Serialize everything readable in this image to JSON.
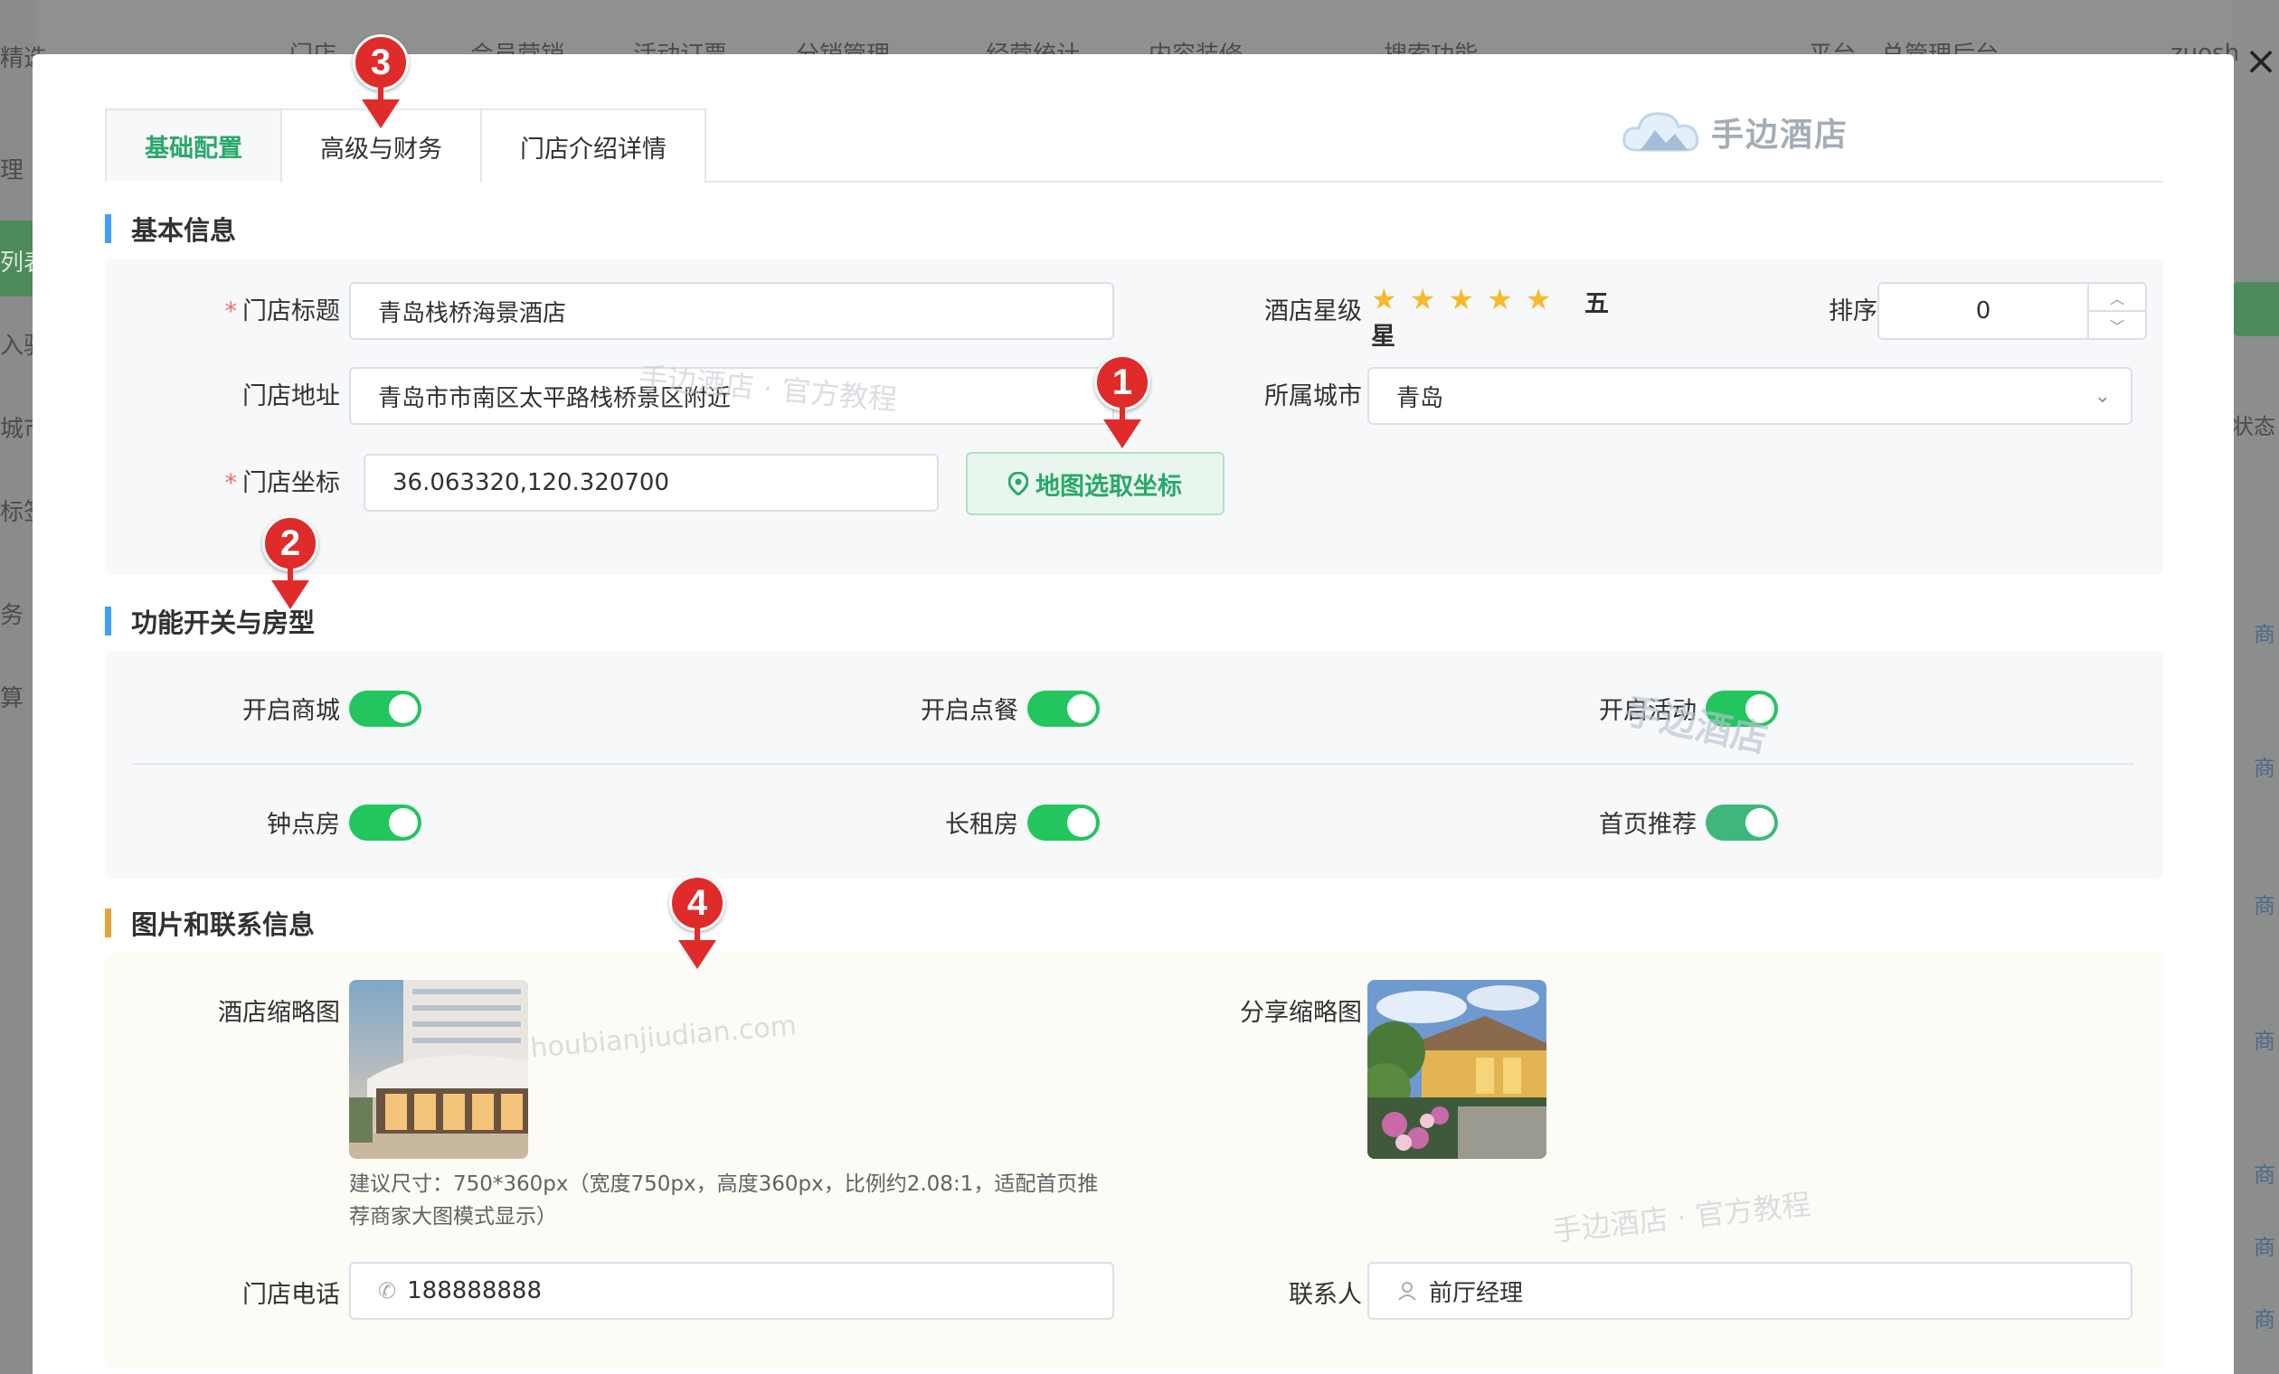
{
  "background": {
    "top_items": [
      "精选",
      "门店",
      "会员营销",
      "活动订票",
      "分销管理",
      "经营统计",
      "内容装修",
      "搜索功能",
      "平台",
      "总管理后台",
      "zuosh"
    ],
    "left_items": [
      "理",
      "列表",
      "入驻",
      "城市",
      "标签",
      "务",
      "算"
    ],
    "right_items": [
      "状态",
      "商",
      "商",
      "商",
      "商",
      "商",
      "商",
      "商"
    ]
  },
  "tabs": [
    {
      "label": "基础配置",
      "active": true
    },
    {
      "label": "高级与财务",
      "active": false
    },
    {
      "label": "门店介绍详情",
      "active": false
    }
  ],
  "brand": {
    "logo_text": "手边酒店"
  },
  "sections": {
    "basic": {
      "title": "基本信息"
    },
    "features": {
      "title": "功能开关与房型"
    },
    "media": {
      "title": "图片和联系信息"
    }
  },
  "basic": {
    "store_title_label": "门店标题",
    "store_title_value": "青岛栈桥海景酒店",
    "address_label": "门店地址",
    "address_value": "青岛市市南区太平路栈桥景区附近",
    "coord_label": "门店坐标",
    "coord_value": "36.063320,120.320700",
    "map_button": "地图选取坐标",
    "star_label": "酒店星级",
    "star_rating": 5,
    "star_text_1": "五",
    "star_text_2": "星",
    "sort_label": "排序",
    "sort_value": "0",
    "city_label": "所属城市",
    "city_value": "青岛"
  },
  "features": {
    "toggles": [
      {
        "label": "开启商城",
        "on": true
      },
      {
        "label": "开启点餐",
        "on": true
      },
      {
        "label": "开启活动",
        "on": true
      },
      {
        "label": "钟点房",
        "on": true
      },
      {
        "label": "长租房",
        "on": true
      },
      {
        "label": "首页推荐",
        "on": true
      }
    ]
  },
  "media": {
    "thumb_label": "酒店缩略图",
    "share_label": "分享缩略图",
    "hint_1": "建议尺寸：750*360px（宽度750px，高度360px，比例约2.08:1，适配首页推",
    "hint_2": "荐商家大图模式显示）",
    "phone_label": "门店电话",
    "phone_value": "188888888",
    "contact_label": "联系人",
    "contact_value": "前厅经理"
  },
  "watermarks": {
    "wm1": "手边酒店 · 官方教程",
    "wm2": "手边酒店",
    "wm3": "houbianjiudian.com",
    "wm4": "手边酒店 · 官方教程"
  },
  "markers": [
    "1",
    "2",
    "3",
    "4"
  ],
  "colors": {
    "accent": "#2aa86b",
    "toggle_on": "#22c55e",
    "marker": "#e02b2b",
    "section_bar": "#409eff",
    "section_bar_media": "#e6a23c"
  }
}
